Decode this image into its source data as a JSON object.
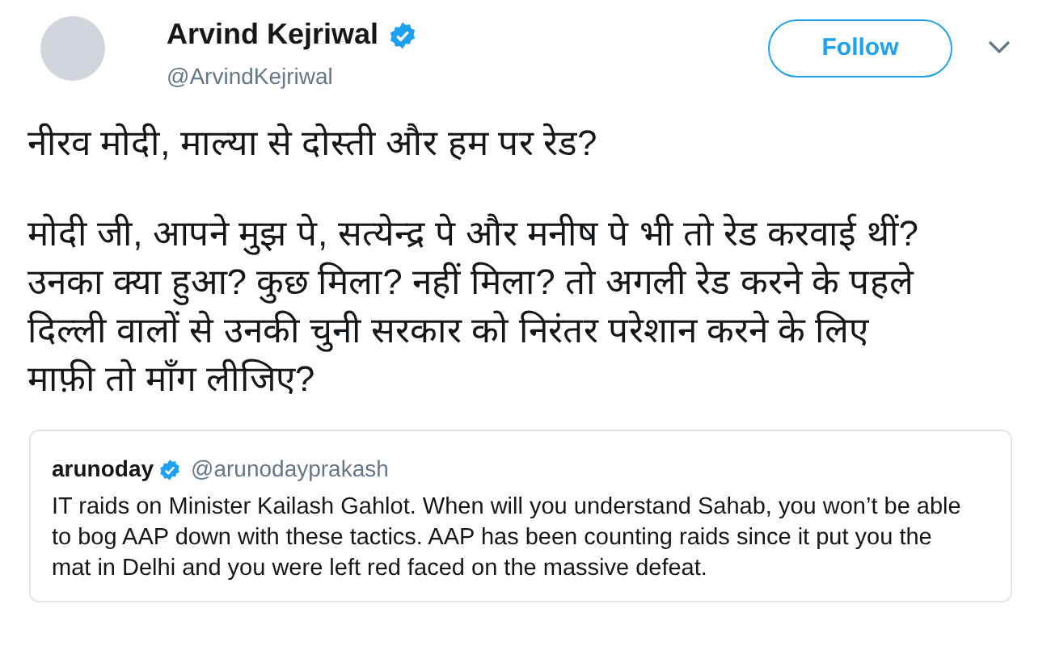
{
  "author": {
    "name": "Arvind Kejriwal",
    "handle": "@ArvindKejriwal",
    "verified": true
  },
  "follow_button": {
    "label": "Follow"
  },
  "tweet_paragraphs": [
    "नीरव मोदी, माल्या से दोस्ती और हम पर रेड?",
    "मोदी जी, आपने मुझ पे, सत्येन्द्र पे और मनीष पे भी तो रेड करवाई थीं? उनका क्या हुआ? कुछ मिला? नहीं मिला? तो अगली रेड करने के पहले दिल्ली वालों से उनकी चुनी सरकार को निरंतर परेशान करने के लिए माफ़ी तो माँग लीजिए?"
  ],
  "quoted_tweet": {
    "name": "arunoday",
    "handle": "@arunodayprakash",
    "verified": true,
    "text": "IT raids on Minister Kailash Gahlot. When will you understand Sahab, you won’t be able to bog AAP down with these tactics. AAP has been counting raids since it put you the mat in Delhi and you were left red faced on the massive defeat."
  }
}
